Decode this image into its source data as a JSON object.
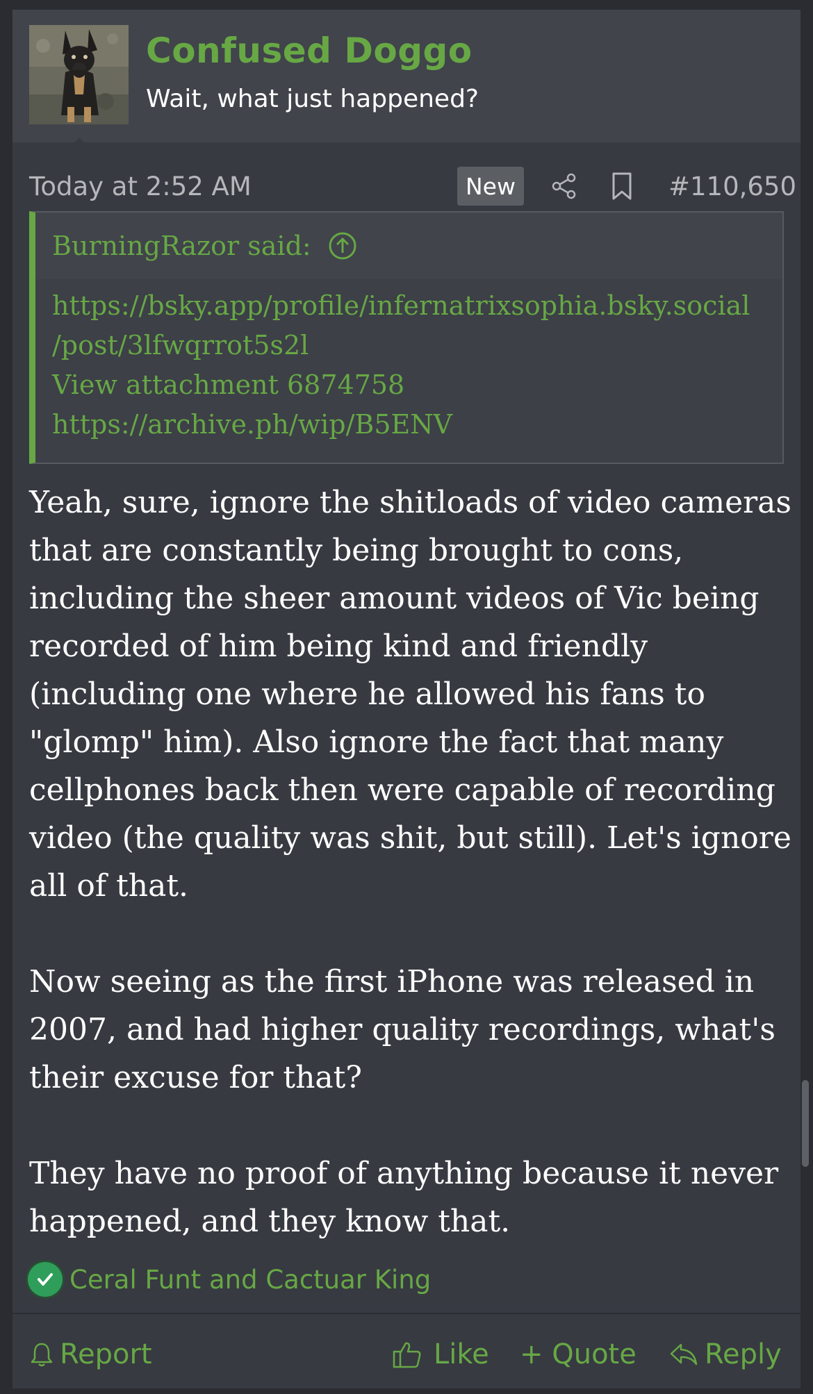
{
  "user": {
    "name": "Confused Doggo",
    "title": "Wait, what just happened?",
    "avatar_icon": "dog-photo-avatar"
  },
  "meta": {
    "timestamp": "Today at 2:52 AM",
    "badge": "New",
    "post_number": "#110,650"
  },
  "quote": {
    "author": "BurningRazor said:",
    "lines": [
      "https://bsky.app/profile/infernatrixsophia.bsky.social",
      "/post/3lfwqrrot5s2l",
      "View attachment 6874758",
      "https://archive.ph/wip/B5ENV"
    ]
  },
  "body": {
    "lines": [
      "Yeah, sure, ignore the shitloads of video cameras",
      "that are constantly being brought to cons,",
      "including the sheer amount videos of Vic being",
      "recorded of him being kind and friendly",
      "(including one where he allowed his fans to",
      "\"glomp\" him). Also ignore the fact that many",
      "cellphones back then were capable of recording",
      "video (the quality was shit, but still). Let's ignore",
      "all of that.",
      "",
      "Now seeing as the first iPhone was released in",
      "2007, and had higher quality recordings, what's",
      "their excuse for that?",
      "",
      "They have no proof of anything because it never",
      "happened, and they know that."
    ]
  },
  "reactions": {
    "names": "Ceral Funt and Cactuar King",
    "icon": "checkmark-reaction-icon"
  },
  "actions": {
    "report": "Report",
    "like": "Like",
    "quote": "+ Quote",
    "reply": "Reply"
  },
  "colors": {
    "accent": "#67a845",
    "background": "#373a41",
    "header": "#41444b"
  }
}
